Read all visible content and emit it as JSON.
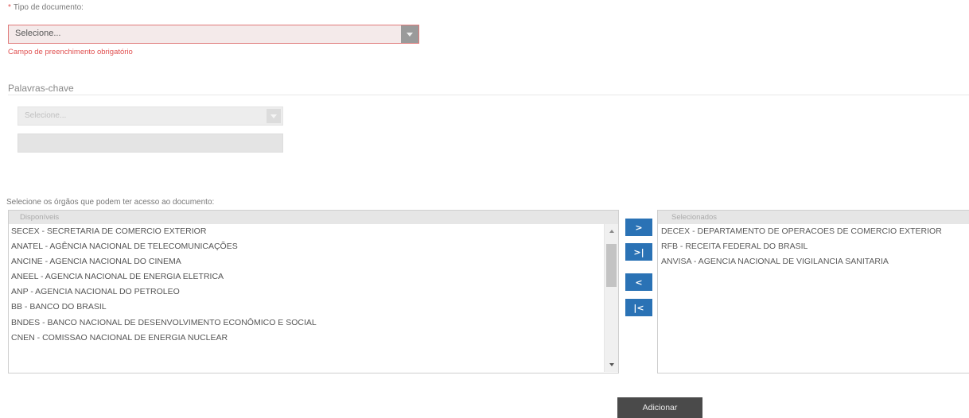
{
  "document_type": {
    "required_mark": "*",
    "label": "Tipo de documento:",
    "selected_value": "Selecione...",
    "error_message": "Campo de preenchimento obrigatório"
  },
  "keywords": {
    "title": "Palavras-chave",
    "select_placeholder": "Selecione...",
    "input_value": ""
  },
  "organs": {
    "label": "Selecione os órgãos que podem ter acesso ao documento:",
    "available_header": "Disponíveis",
    "available_items": [
      "SECEX - SECRETARIA DE COMERCIO EXTERIOR",
      "ANATEL - AGÊNCIA NACIONAL DE TELECOMUNICAÇÕES",
      "ANCINE - AGENCIA NACIONAL DO CINEMA",
      "ANEEL - AGENCIA NACIONAL DE ENERGIA ELETRICA",
      "ANP - AGENCIA NACIONAL DO PETROLEO",
      "BB - BANCO DO BRASIL",
      "BNDES - BANCO NACIONAL DE DESENVOLVIMENTO ECONÔMICO E SOCIAL",
      "CNEN - COMISSAO NACIONAL DE ENERGIA NUCLEAR"
    ],
    "selected_header": "Selecionados",
    "selected_items": [
      "DECEX - DEPARTAMENTO DE OPERACOES DE COMERCIO EXTERIOR",
      "RFB - RECEITA FEDERAL DO BRASIL",
      "ANVISA - AGENCIA NACIONAL DE VIGILANCIA SANITARIA"
    ],
    "buttons": {
      "move_right": ">",
      "move_all_right": ">|",
      "move_left": "<",
      "move_all_left": "|<"
    }
  },
  "actions": {
    "add_label": "Adicionar"
  },
  "colors": {
    "error": "#e05050",
    "transfer_button": "#2a72b5",
    "add_button": "#4a4a4a"
  }
}
